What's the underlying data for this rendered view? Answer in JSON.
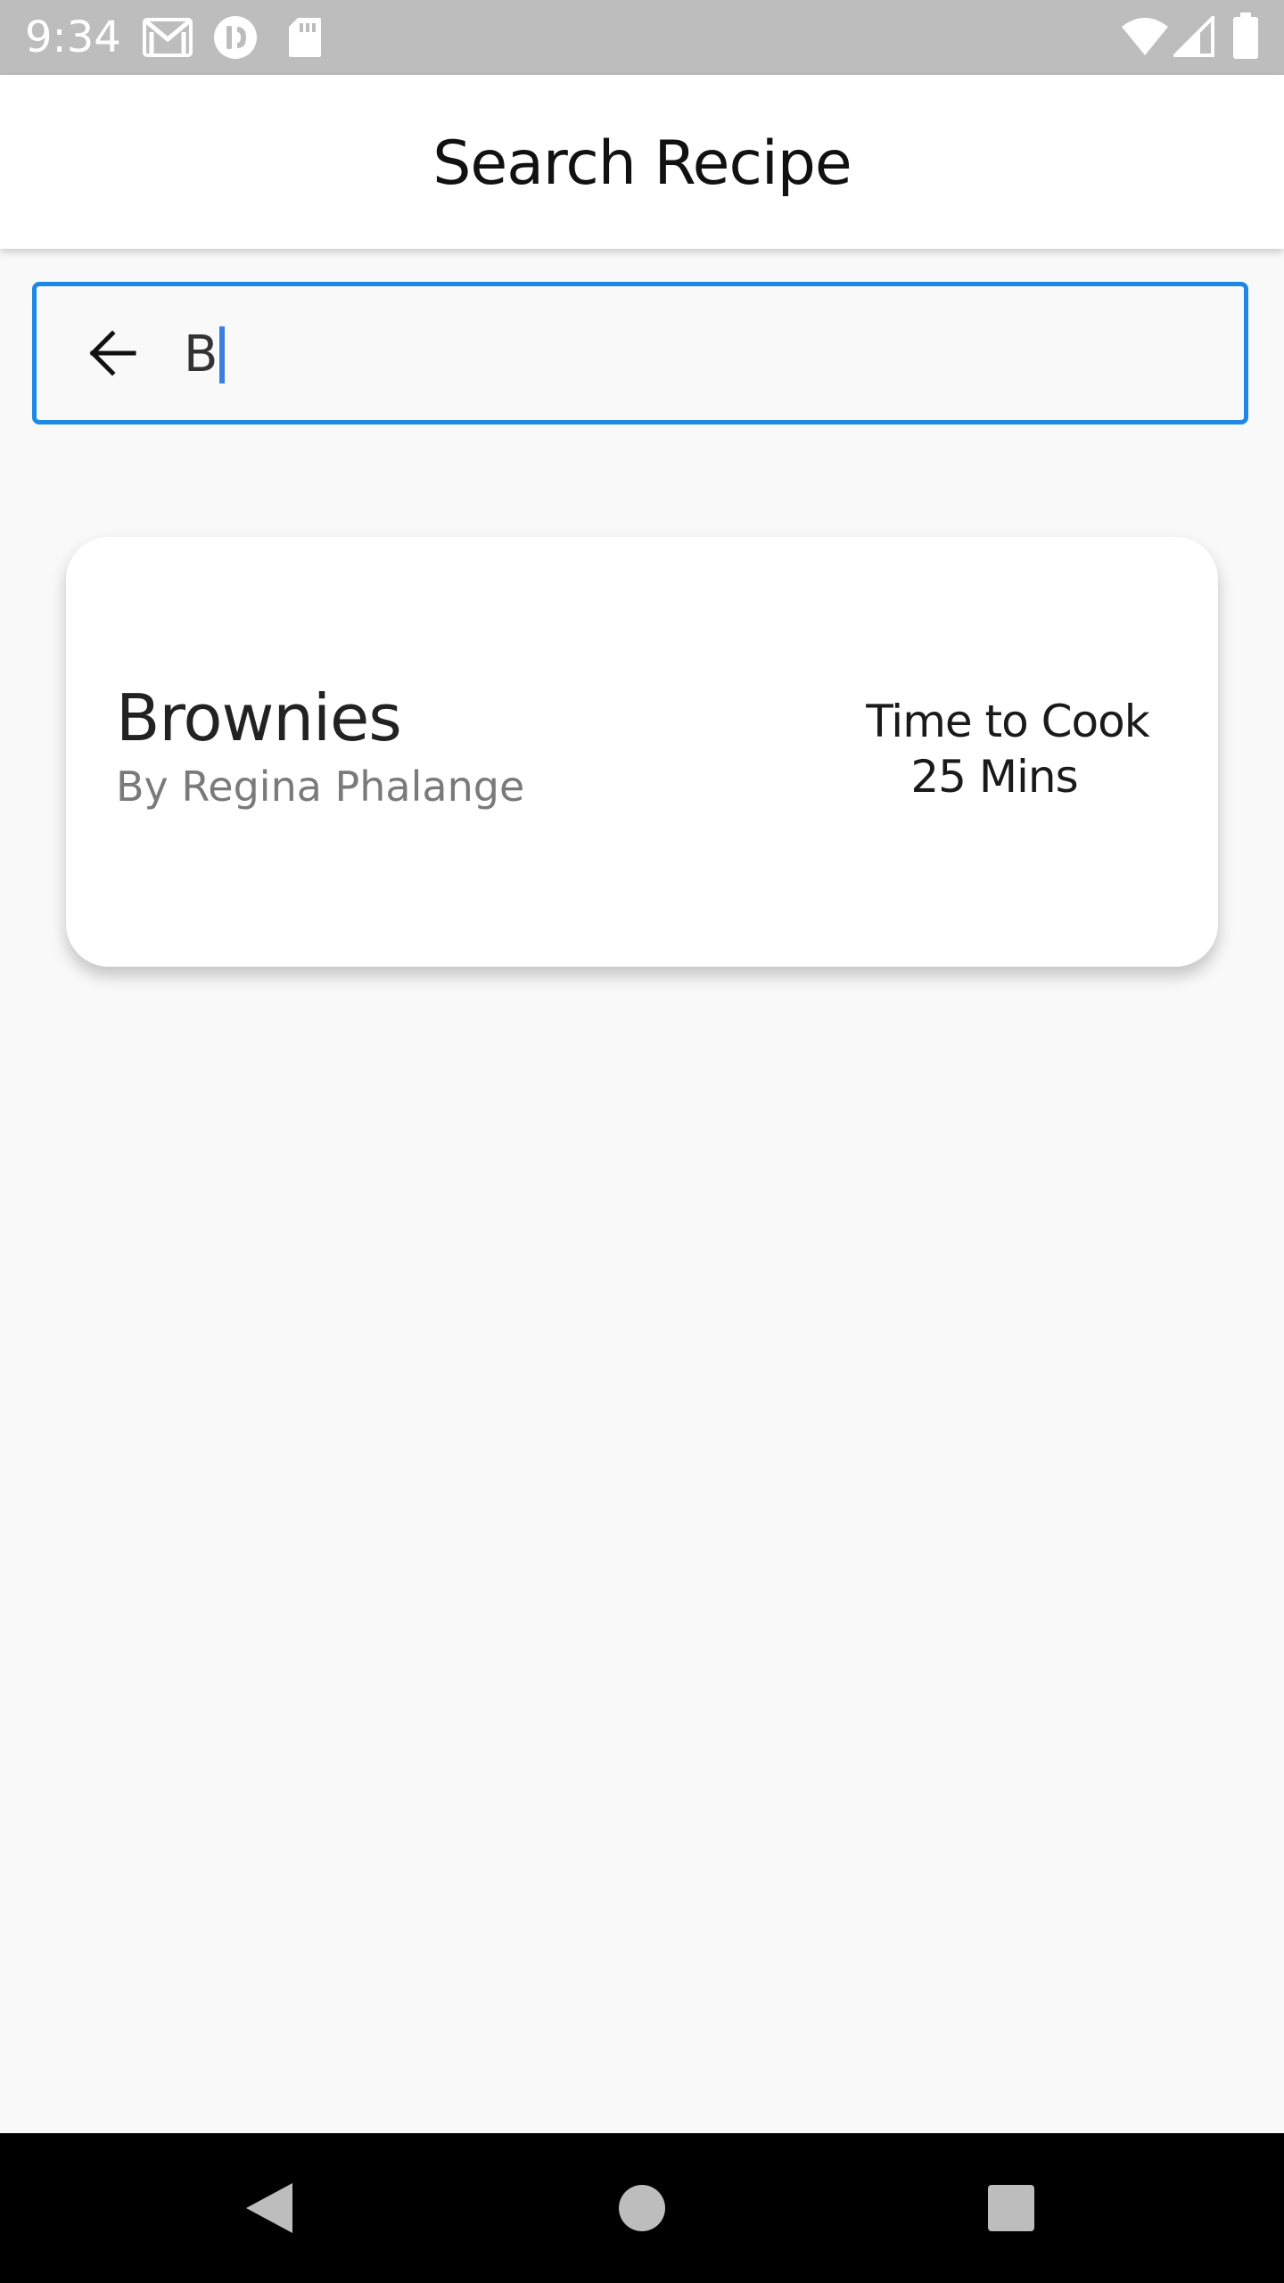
{
  "status_bar": {
    "time": "9:34",
    "left_icons": [
      "gmail-icon",
      "nfc-icon",
      "sd-card-icon"
    ],
    "right_icons": [
      "wifi-icon",
      "signal-icon",
      "battery-icon"
    ]
  },
  "app_bar": {
    "title": "Search Recipe"
  },
  "search": {
    "value": "B",
    "back_icon": "arrow-back-icon",
    "accent_color": "#1e88e5"
  },
  "results": [
    {
      "name": "Brownies",
      "author": "By Regina Phalange",
      "cook_label": "Time to Cook",
      "cook_time": "25 Mins"
    }
  ],
  "nav_bar": {
    "buttons": [
      "back-triangle-icon",
      "home-circle-icon",
      "recents-square-icon"
    ]
  }
}
